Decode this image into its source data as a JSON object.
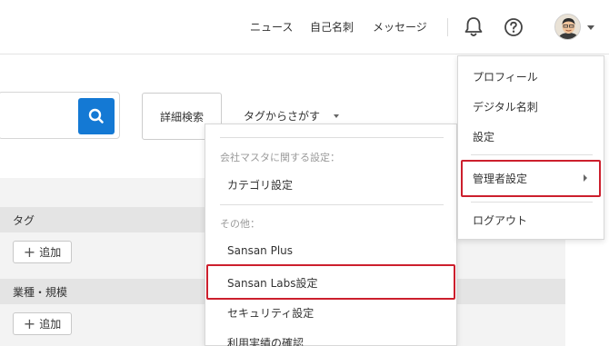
{
  "header": {
    "nav": {
      "news": "ニュース",
      "profile_card": "自己名刺",
      "messages": "メッセージ"
    },
    "icons": {
      "notifications": "bell-icon",
      "help": "help-circle-icon",
      "user": "avatar",
      "menu_caret": "chevron-down-icon"
    }
  },
  "search": {
    "button_icon": "search-icon",
    "accent_color": "#1479d4",
    "advanced_label": "詳細検索",
    "tag_search_label": "タグからさがす"
  },
  "sections": [
    {
      "title": "タグ",
      "add_label": "追加"
    },
    {
      "title": "業種・規模",
      "add_label": "追加"
    }
  ],
  "settings_dropdown": {
    "groups": [
      {
        "heading": "会社マスタに関する設定：",
        "items": [
          "カテゴリ設定"
        ]
      },
      {
        "heading": "その他：",
        "items": [
          "Sansan Plus",
          "Sansan Labs設定",
          "セキュリティ設定",
          "利用実績の確認"
        ]
      }
    ],
    "highlighted_item": "Sansan Labs設定",
    "highlight_color": "#cc1f2d"
  },
  "user_menu": {
    "items": [
      "プロフィール",
      "デジタル名刺",
      "設定",
      "管理者設定",
      "ログアウト"
    ],
    "highlighted_item": "管理者設定"
  }
}
